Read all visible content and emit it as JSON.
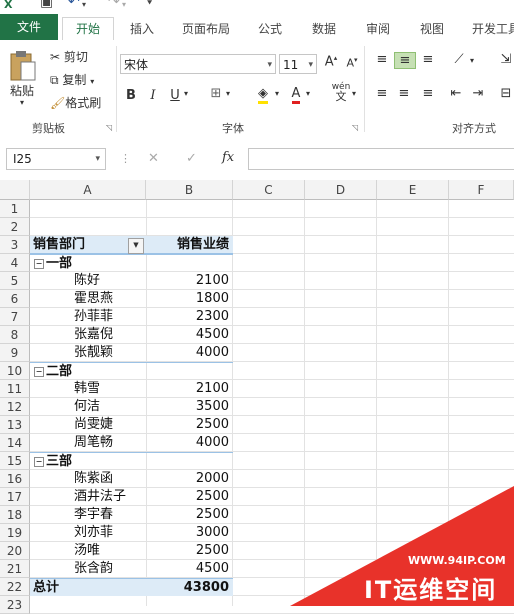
{
  "quick_access": {
    "save_icon": "save-icon",
    "undo_icon": "undo-icon",
    "redo_icon": "redo-icon"
  },
  "tabs": [
    "文件",
    "开始",
    "插入",
    "页面布局",
    "公式",
    "数据",
    "审阅",
    "视图",
    "开发工具"
  ],
  "ribbon": {
    "clipboard": {
      "paste": "粘贴",
      "cut": "剪切",
      "copy": "复制",
      "format_painter": "格式刷",
      "label": "剪贴板"
    },
    "font": {
      "font_name": "宋体",
      "font_size": "11",
      "bold": "B",
      "italic": "I",
      "underline": "U",
      "wen": "wén",
      "wen_char": "文",
      "label": "字体"
    },
    "alignment": {
      "label": "对齐方式"
    }
  },
  "formula_bar": {
    "name_box": "I25",
    "cancel": "✕",
    "enter": "✓",
    "fx": "fx",
    "formula": ""
  },
  "columns": [
    "A",
    "B",
    "C",
    "D",
    "E",
    "F"
  ],
  "rows": [
    "1",
    "2",
    "3",
    "4",
    "5",
    "6",
    "7",
    "8",
    "9",
    "10",
    "11",
    "12",
    "13",
    "14",
    "15",
    "16",
    "17",
    "18",
    "19",
    "20",
    "21",
    "22",
    "23"
  ],
  "pivot": {
    "header_dept": "销售部门",
    "header_perf": "销售业绩",
    "groups": [
      {
        "name": "一部",
        "items": [
          {
            "name": "陈好",
            "value": "2100"
          },
          {
            "name": "霍思燕",
            "value": "1800"
          },
          {
            "name": "孙菲菲",
            "value": "2300"
          },
          {
            "name": "张嘉倪",
            "value": "4500"
          },
          {
            "name": "张靓颖",
            "value": "4000"
          }
        ]
      },
      {
        "name": "二部",
        "items": [
          {
            "name": "韩雪",
            "value": "2100"
          },
          {
            "name": "何洁",
            "value": "3500"
          },
          {
            "name": "尚雯婕",
            "value": "2500"
          },
          {
            "name": "周笔畅",
            "value": "4000"
          }
        ]
      },
      {
        "name": "三部",
        "items": [
          {
            "name": "陈紫函",
            "value": "2000"
          },
          {
            "name": "酒井法子",
            "value": "2500"
          },
          {
            "name": "李宇春",
            "value": "2500"
          },
          {
            "name": "刘亦菲",
            "value": "3000"
          },
          {
            "name": "汤唯",
            "value": "2500"
          },
          {
            "name": "张含韵",
            "value": "4500"
          }
        ]
      }
    ],
    "total_label": "总计",
    "total_value": "43800"
  },
  "watermark": {
    "url": "WWW.94IP.COM",
    "brand": "IT运维空间"
  },
  "colors": {
    "excel_green": "#217346",
    "pivot_blue": "#ddebf7",
    "watermark_red": "#e8322a"
  }
}
